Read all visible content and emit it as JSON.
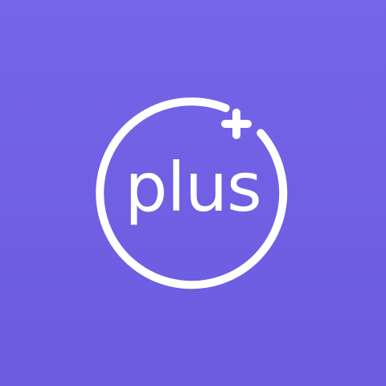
{
  "app_icon": {
    "wordmark": "plus",
    "symbol": "plus-icon",
    "colors": {
      "background_top": "#7565e9",
      "background_bottom": "#6c5bdf",
      "foreground": "#ffffff"
    }
  }
}
